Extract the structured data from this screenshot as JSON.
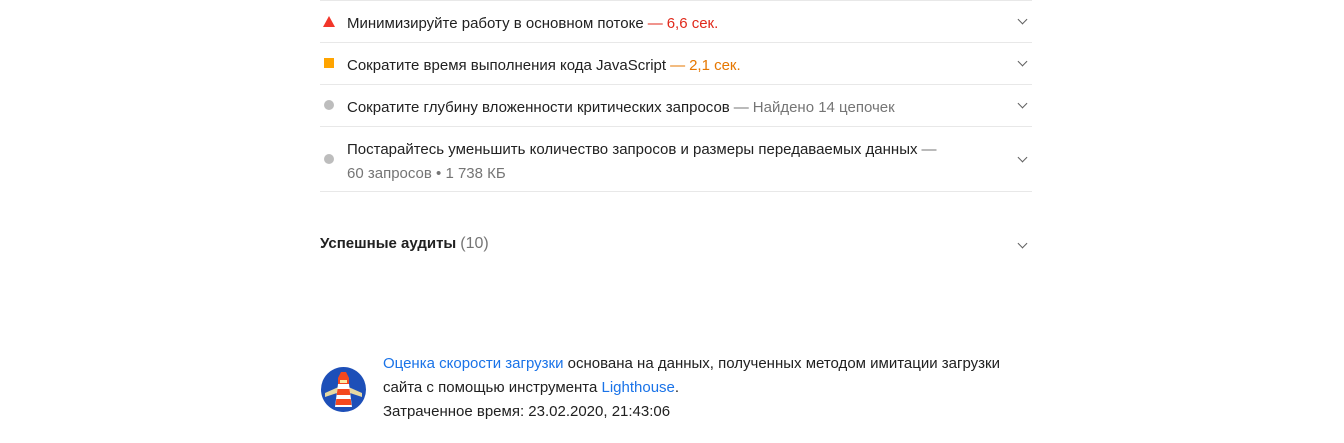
{
  "audits": [
    {
      "title": "Минимизируйте работу в основном потоке",
      "separator": "—",
      "metric": "6,6 сек.",
      "status": "fail",
      "marker_icon": "red-triangle-icon"
    },
    {
      "title": "Сократите время выполнения кода JavaScript",
      "separator": "—",
      "metric": "2,1 сек.",
      "status": "average",
      "marker_icon": "orange-square-icon"
    },
    {
      "title": "Сократите глубину вложенности критических запросов",
      "separator": "—",
      "metric": "Найдено 14 цепочек",
      "status": "informative",
      "marker_icon": "gray-circle-icon"
    },
    {
      "title": "Постарайтесь уменьшить количество запросов и размеры передаваемых данных",
      "separator": "—",
      "metric": "60 запросов • 1 738 КБ",
      "status": "informative",
      "marker_icon": "gray-circle-icon"
    }
  ],
  "passed": {
    "title": "Успешные аудиты",
    "count": "(10)"
  },
  "footer": {
    "link1": "Оценка скорости загрузки",
    "text1": " основана на данных, полученных методом имитации загрузки сайта с помощью инструмента ",
    "link2": "Lighthouse",
    "text2": ".",
    "time_label": "Затраченное время: 23.02.2020, 21:43:06",
    "logo_icon": "lighthouse-logo-icon"
  },
  "colors": {
    "fail": "#e0291b",
    "average": "#e67700",
    "informative": "#757575",
    "link": "#1a73e8",
    "logo_bg": "#1d4fb8"
  }
}
